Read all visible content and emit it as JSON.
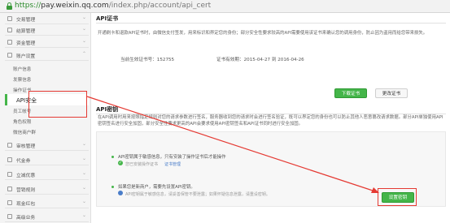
{
  "browser": {
    "url_scheme": "https://",
    "url_host": "pay.weixin.qq.com",
    "url_path": "/index.php/account/api_cert"
  },
  "sidebar": {
    "groups": [
      {
        "label": "交易管理",
        "name": "nav-group-trade"
      },
      {
        "label": "结算管理",
        "name": "nav-group-settle"
      },
      {
        "label": "资金管理",
        "name": "nav-group-funds"
      },
      {
        "label": "账户设置",
        "name": "nav-group-account"
      }
    ],
    "subitems": [
      {
        "label": "账户信息",
        "name": "sidebar-item-account-info"
      },
      {
        "label": "发票信息",
        "name": "sidebar-item-invoice"
      },
      {
        "label": "操作证书",
        "name": "sidebar-item-op-cert"
      },
      {
        "label": "API安全",
        "name": "sidebar-item-api-security",
        "active": true
      },
      {
        "label": "员工帐号",
        "name": "sidebar-item-staff"
      },
      {
        "label": "角色权限",
        "name": "sidebar-item-roles"
      },
      {
        "label": "微信商户群",
        "name": "sidebar-item-merchant-group"
      }
    ],
    "groups2": [
      {
        "label": "审核管理",
        "name": "nav-group-audit"
      },
      {
        "label": "代金券",
        "name": "nav-group-coupon"
      },
      {
        "label": "立减优惠",
        "name": "nav-group-discount"
      },
      {
        "label": "营销规则",
        "name": "nav-group-marketing"
      },
      {
        "label": "现金红包",
        "name": "nav-group-redpack"
      },
      {
        "label": "高级业务",
        "name": "nav-group-advanced"
      }
    ]
  },
  "cert_section": {
    "title": "API证书",
    "desc": "开通刷卡和退款API证书时，由微信支付签发，用来标识和界定您的身份；部分安全性要求较高的API需要使用该证书来确认您的调用身份，防止因为盗用而给您带来损失。",
    "serial_label": "当前生效证书号：",
    "serial_value": "152755",
    "valid_label": "证书有效期：",
    "valid_value": "2015-04-27  到  2016-04-26",
    "download_btn": "下载证书",
    "update_btn": "更改证书"
  },
  "key_section": {
    "title": "API密钥",
    "desc": "在API调用时用来按照指定规则对您的请求参数进行签名，服务器收到您的请求时会进行签名验证，既可以界定您的身份也可以防止其他人恶意篡改请求数据。部分API单独使用API密钥签名进行安全加固，部分安全性要求更高的API会要求使用API密钥签名和API证书同时进行安全加固。",
    "line1": "API密钥属于敏感信息，只有安装了操作证书后才能操作",
    "line1_status": "您已安装操作证书",
    "line1_link": "证书管理",
    "line2": "如果您是新商户，需要先设置API密钥。",
    "line2_sub": "API密钥属于敏感信息，请妥善保管不要泄露；如果怀疑信息泄露，请重设密钥。",
    "set_btn": "设置密钥"
  }
}
